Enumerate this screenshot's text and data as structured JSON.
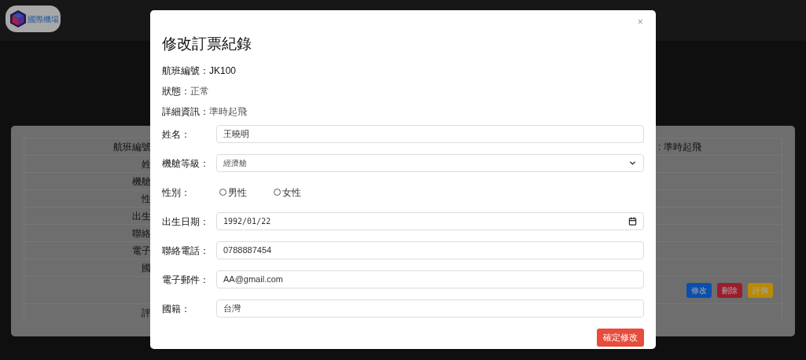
{
  "header": {
    "logo_text": "國際機場"
  },
  "background_card": {
    "rows": [
      {
        "label": "航班編號",
        "value": ": 準時起飛"
      },
      {
        "label": "姓"
      },
      {
        "label": "機艙"
      },
      {
        "label": "性"
      },
      {
        "label": "出生"
      },
      {
        "label": "聯絡"
      },
      {
        "label": "電子"
      },
      {
        "label": "國"
      },
      {
        "actions": [
          {
            "label": "修改",
            "kind": "edit"
          },
          {
            "label": "刪除",
            "kind": "delete"
          },
          {
            "label": "評價",
            "kind": "rate"
          }
        ]
      },
      {
        "label": "評"
      }
    ]
  },
  "modal": {
    "title": "修改訂票紀錄",
    "close": "×",
    "info": [
      {
        "label": "航班編號：",
        "value": "JK100"
      },
      {
        "label": "狀態：",
        "value": "正常"
      },
      {
        "label": "詳細資訊：",
        "value": "準時起飛"
      }
    ],
    "fields": [
      {
        "label": "姓名：",
        "kind": "text",
        "value": "王曉明"
      },
      {
        "label": "機艙等級：",
        "kind": "select",
        "value": "經濟艙"
      },
      {
        "label": "性別：",
        "kind": "radio",
        "options": [
          {
            "label": "男性",
            "selected": false
          },
          {
            "label": "女性",
            "selected": false
          }
        ]
      },
      {
        "label": "出生日期：",
        "kind": "date",
        "value": "1992/01/22"
      },
      {
        "label": "聯絡電話：",
        "kind": "text",
        "value": "0788887454"
      },
      {
        "label": "電子郵件：",
        "kind": "text",
        "value": "AA@gmail.com"
      },
      {
        "label": "國籍：",
        "kind": "text",
        "value": "台灣"
      }
    ],
    "submit": "確定修改"
  }
}
